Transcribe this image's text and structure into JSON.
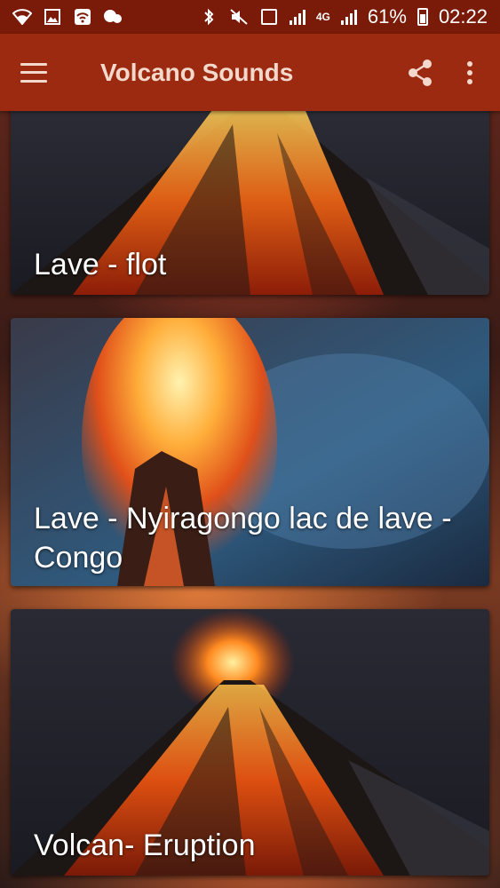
{
  "status_bar": {
    "battery_percent": "61%",
    "time": "02:22",
    "network": "4G",
    "icons_left": [
      "wifi-icon",
      "image-icon",
      "wifi-hotspot-icon",
      "chat-icon"
    ],
    "icons_right": [
      "bluetooth-icon",
      "mute-icon",
      "sim-icon",
      "signal-icon",
      "battery-icon"
    ]
  },
  "app_bar": {
    "title": "Volcano Sounds",
    "menu_icon": "hamburger-menu-icon",
    "share_icon": "share-icon",
    "overflow_icon": "more-vert-icon"
  },
  "colors": {
    "status_bar": "#7a1a08",
    "app_bar": "#9b2a10",
    "app_bar_text": "#f3d8cc"
  },
  "sounds": [
    {
      "label": "Lave - flot"
    },
    {
      "label": "Lave - Nyiragongo lac de lave - Congo"
    },
    {
      "label": "Volcan- Eruption"
    }
  ]
}
